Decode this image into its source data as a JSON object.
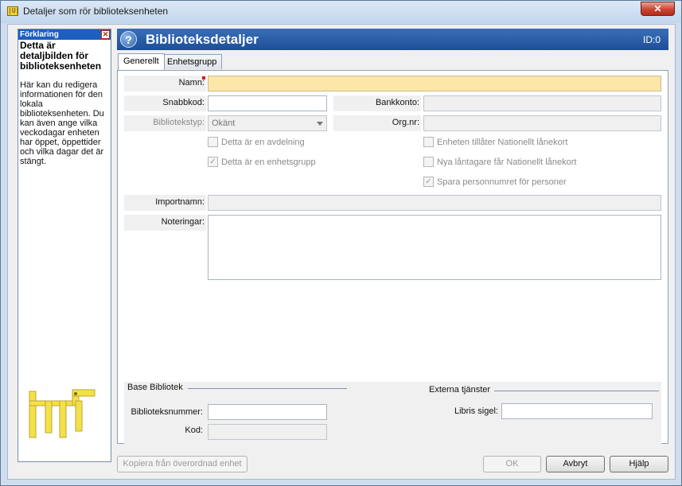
{
  "window": {
    "title": "Detaljer som rör biblioteksenheten",
    "app_icon_text": "|U|",
    "close_glyph": "✕"
  },
  "help": {
    "header": "Förklaring",
    "close_glyph": "✕",
    "title": "Detta är detaljbilden för biblioteksenheten",
    "body": "Här kan du redigera informationen för den lokala biblioteksenheten. Du kan även ange vilka veckodagar enheten har öppet, öppettider och vilka dagar det är stängt."
  },
  "banner": {
    "icon_glyph": "?",
    "title": "Biblioteksdetaljer",
    "id": "ID:0"
  },
  "tabs": [
    {
      "label": "Generellt",
      "active": true
    },
    {
      "label": "Enhetsgrupp",
      "active": false
    }
  ],
  "form": {
    "namn_label": "Namn:",
    "snabbkod_label": "Snabbkod:",
    "bibliotekstyp_label": "Bibliotekstyp:",
    "bibliotekstyp_value": "Okänt",
    "bankkonto_label": "Bankkonto:",
    "orgnr_label": "Org.nr:",
    "importnamn_label": "Importnamn:",
    "noteringar_label": "Noteringar:",
    "checkboxes_left": [
      {
        "label": "Detta är en avdelning",
        "checked": false
      },
      {
        "label": "Detta är en enhetsgrupp",
        "checked": true
      }
    ],
    "checkboxes_right": [
      {
        "label": "Enheten tillåter Nationellt lånekort",
        "checked": false
      },
      {
        "label": "Nya låntagare får Nationellt lånekort",
        "checked": false
      },
      {
        "label": "Spara personnumret för personer",
        "checked": true
      }
    ],
    "check_glyph": "✓"
  },
  "base_bibliotek": {
    "title": "Base Bibliotek",
    "biblioteksnummer_label": "Biblioteksnummer:",
    "kod_label": "Kod:"
  },
  "externa": {
    "title": "Externa tjänster",
    "libris_label": "Libris sigel:"
  },
  "buttons": {
    "kopiera": "Kopiera från överordnad enhet",
    "ok": "OK",
    "avbryt": "Avbryt",
    "hjalp": "Hjälp"
  },
  "colors": {
    "banner": "#1d4e97",
    "required_field": "#fde7a8",
    "help_header": "#1c5fbf"
  }
}
